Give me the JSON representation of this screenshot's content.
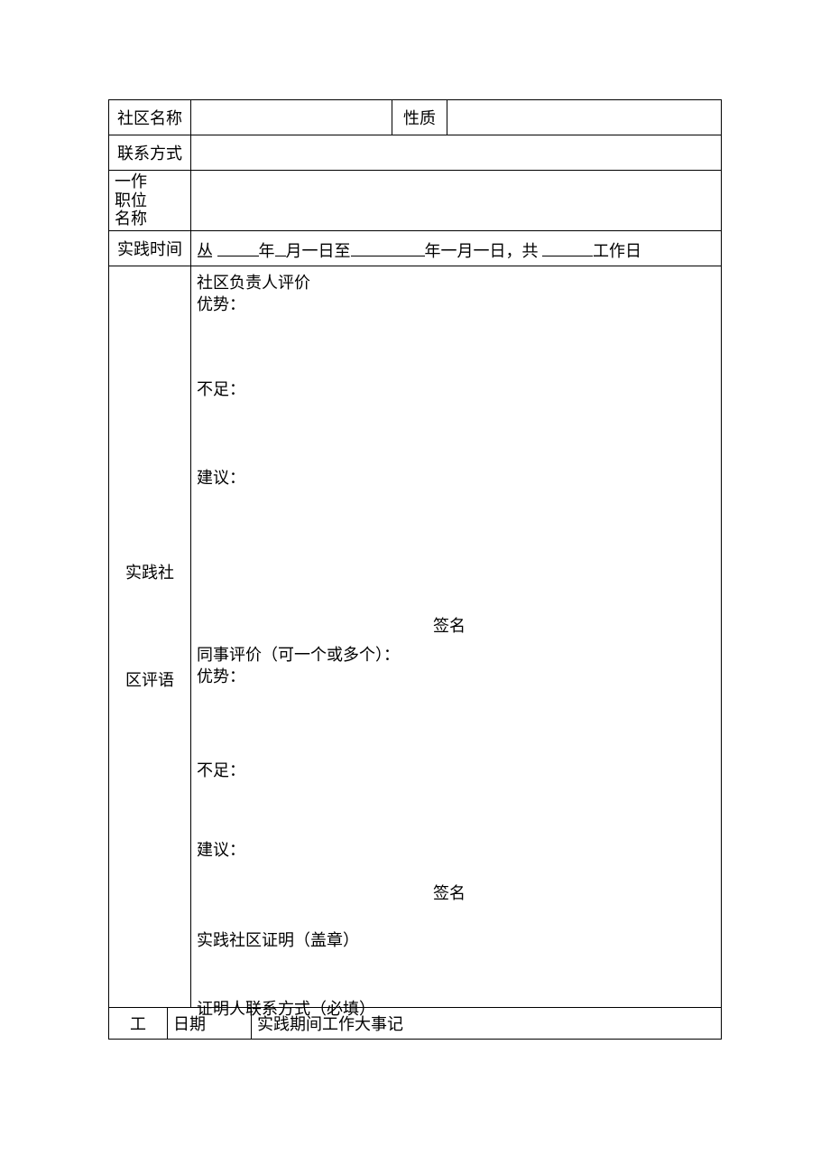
{
  "row1": {
    "label": "社区名称",
    "nature_label": "性质"
  },
  "row2": {
    "label": "联系方式"
  },
  "row3": {
    "label_line1": "一作",
    "label_line2": "职位",
    "label_line3": "名称"
  },
  "row4": {
    "label": "实践时间",
    "prefix": "丛 ",
    "seg_year": "年",
    "seg_month": "月一日至",
    "seg_year2": "年一月一日，共 ",
    "suffix": "工作日"
  },
  "eval": {
    "side_label_1": "实践社",
    "side_label_2": "区评语",
    "leader_eval": "社区负责人评价",
    "strength": "优势：",
    "weakness": "不足：",
    "suggestion": "建议：",
    "signature": "签名",
    "peer_eval": "同事评价（可一个或多个）：",
    "proof": "实践社区证明（盖章）",
    "truncated": "证明人联系方式（必填）"
  },
  "footer": {
    "side_label": "工",
    "date_header": "日期",
    "record_header": "实践期间工作大事记"
  }
}
